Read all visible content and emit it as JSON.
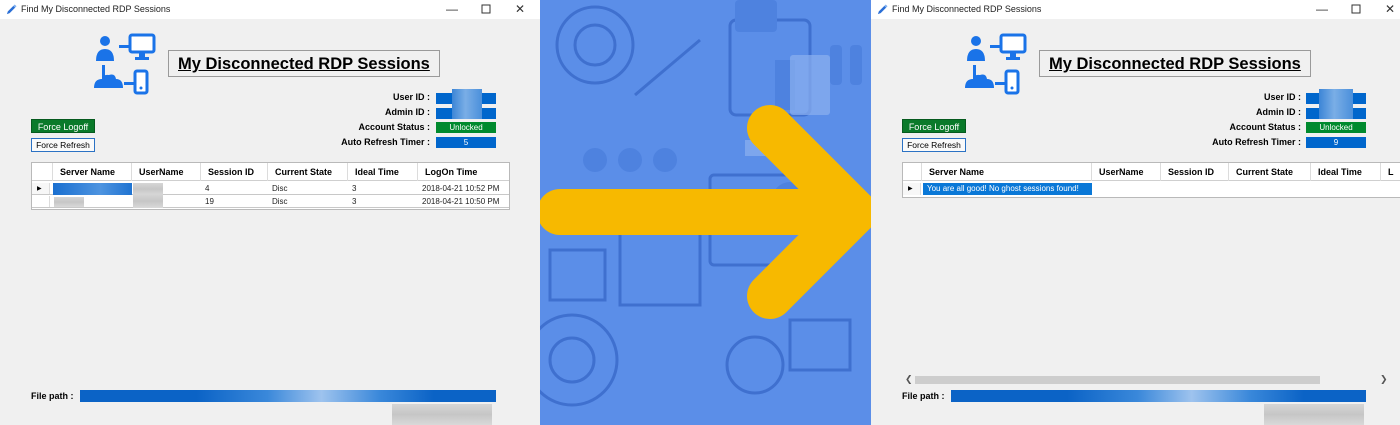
{
  "left_window": {
    "title": "Find My Disconnected RDP Sessions",
    "heading": "My Disconnected RDP Sessions",
    "labels": {
      "user_id": "User ID :",
      "admin_id": "Admin ID :",
      "account_status": "Account Status :",
      "auto_refresh": "Auto Refresh Timer :"
    },
    "account_status_value": "Unlocked",
    "auto_refresh_value": "5",
    "buttons": {
      "force_logoff": "Force Logoff",
      "force_refresh": "Force Refresh"
    },
    "grid": {
      "columns": [
        "Server Name",
        "UserName",
        "Session ID",
        "Current State",
        "Ideal Time",
        "LogOn Time"
      ],
      "rows": [
        {
          "session_id": "4",
          "state": "Disc",
          "ideal_time": "3",
          "logon_time": "2018-04-21 10:52 PM"
        },
        {
          "session_id": "19",
          "state": "Disc",
          "ideal_time": "3",
          "logon_time": "2018-04-21 10:50 PM"
        }
      ]
    },
    "file_path_label": "File path :"
  },
  "right_window": {
    "title": "Find My Disconnected RDP Sessions",
    "heading": "My Disconnected RDP Sessions",
    "labels": {
      "user_id": "User ID :",
      "admin_id": "Admin ID :",
      "account_status": "Account Status :",
      "auto_refresh": "Auto Refresh Timer :"
    },
    "account_status_value": "Unlocked",
    "auto_refresh_value": "9",
    "buttons": {
      "force_logoff": "Force Logoff",
      "force_refresh": "Force Refresh"
    },
    "grid": {
      "columns": [
        "Server Name",
        "UserName",
        "Session ID",
        "Current State",
        "Ideal Time",
        "L"
      ],
      "message": "You are all good! No ghost sessions found!"
    },
    "file_path_label": "File path :"
  },
  "icons": {
    "app": "pencil-app-icon",
    "logo": "network-users-icon",
    "minimize": "minimize-icon",
    "maximize": "maximize-icon",
    "close": "close-icon",
    "arrow": "arrow-right-icon"
  },
  "colors": {
    "accent_blue": "#0066cc",
    "status_green": "#008a2e",
    "banner_bg": "#5b8ee8",
    "arrow_yellow": "#f7b900"
  }
}
